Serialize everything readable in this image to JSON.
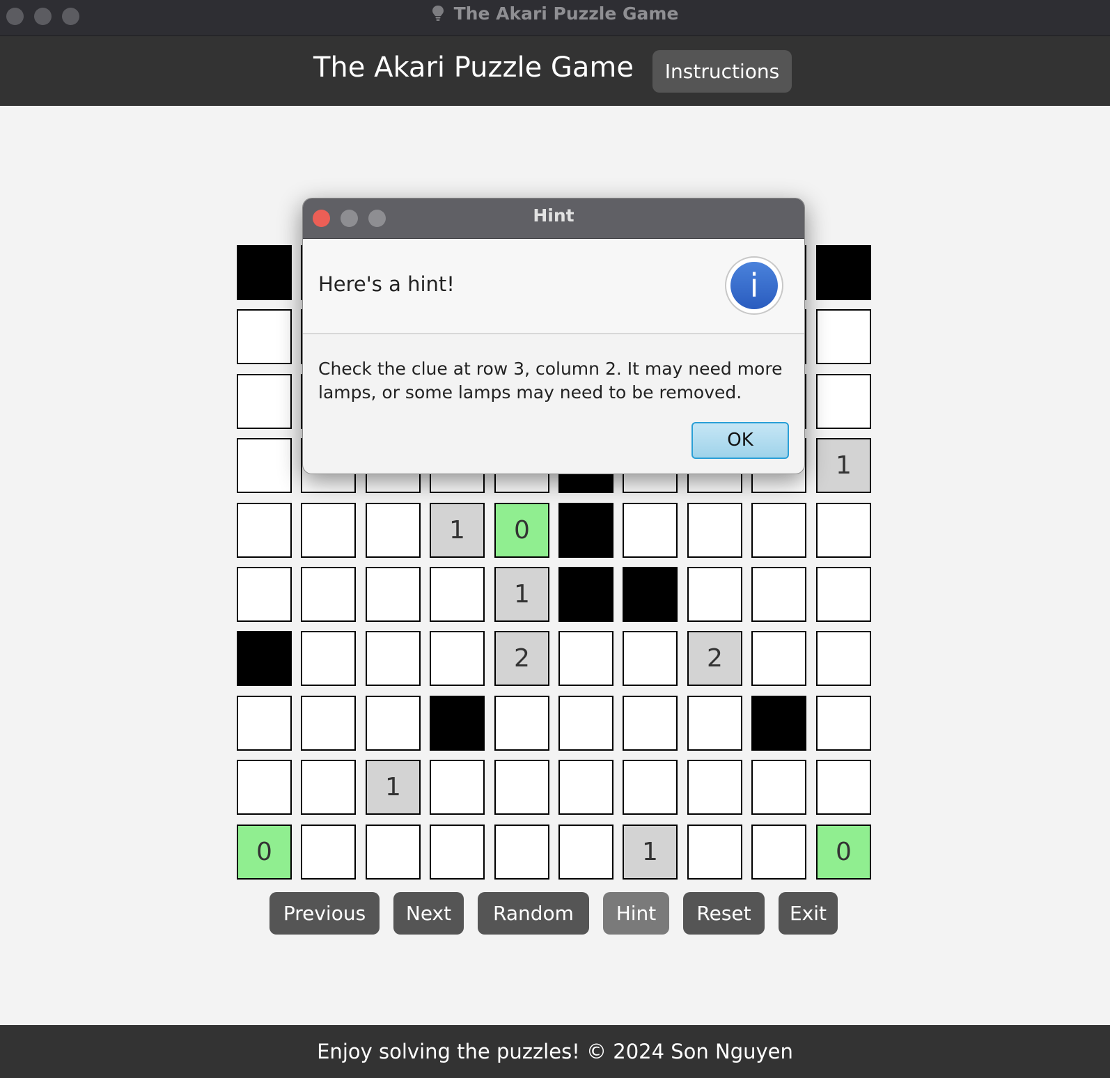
{
  "window": {
    "title": "The Akari Puzzle Game"
  },
  "header": {
    "title": "The Akari Puzzle Game",
    "instructions_label": "Instructions"
  },
  "board": {
    "rows": 10,
    "cols": 10,
    "cells": [
      [
        "B",
        "",
        "",
        "",
        "",
        "",
        "",
        "",
        "",
        "B"
      ],
      [
        "",
        "",
        "",
        "",
        "",
        "",
        "",
        "",
        "",
        ""
      ],
      [
        "",
        "",
        "",
        "",
        "",
        "",
        "",
        "",
        "",
        ""
      ],
      [
        "",
        "",
        "",
        "",
        "",
        "B",
        "",
        "",
        "",
        "1"
      ],
      [
        "",
        "",
        "",
        "1",
        "0",
        "B",
        "",
        "",
        "",
        ""
      ],
      [
        "",
        "",
        "",
        "",
        "1",
        "B",
        "B",
        "",
        "",
        ""
      ],
      [
        "B",
        "",
        "",
        "",
        "2",
        "",
        "",
        "2",
        "",
        ""
      ],
      [
        "",
        "",
        "",
        "B",
        "",
        "",
        "",
        "",
        "B",
        ""
      ],
      [
        "",
        "",
        "1",
        "",
        "",
        "",
        "",
        "",
        "",
        ""
      ],
      [
        "0",
        "",
        "",
        "",
        "",
        "",
        "1",
        "",
        "",
        "0"
      ]
    ],
    "satisfied": [
      [
        4,
        4
      ],
      [
        9,
        0
      ],
      [
        9,
        9
      ]
    ],
    "colors": {
      "wall": "#000000",
      "clue": "#d3d3d3",
      "satisfied": "#90ee90",
      "empty": "#ffffff"
    }
  },
  "controls": [
    {
      "label": "Previous"
    },
    {
      "label": "Next"
    },
    {
      "label": "Random"
    },
    {
      "label": "Hint"
    },
    {
      "label": "Reset"
    },
    {
      "label": "Exit"
    }
  ],
  "footer": {
    "text": "Enjoy solving the puzzles! © 2024 Son Nguyen"
  },
  "dialog": {
    "title": "Hint",
    "header": "Here's a hint!",
    "icon": "info-icon",
    "icon_glyph": "i",
    "content": "Check the clue at row 3, column 2. It may need more lamps, or some lamps may need to be removed.",
    "ok_label": "OK"
  }
}
